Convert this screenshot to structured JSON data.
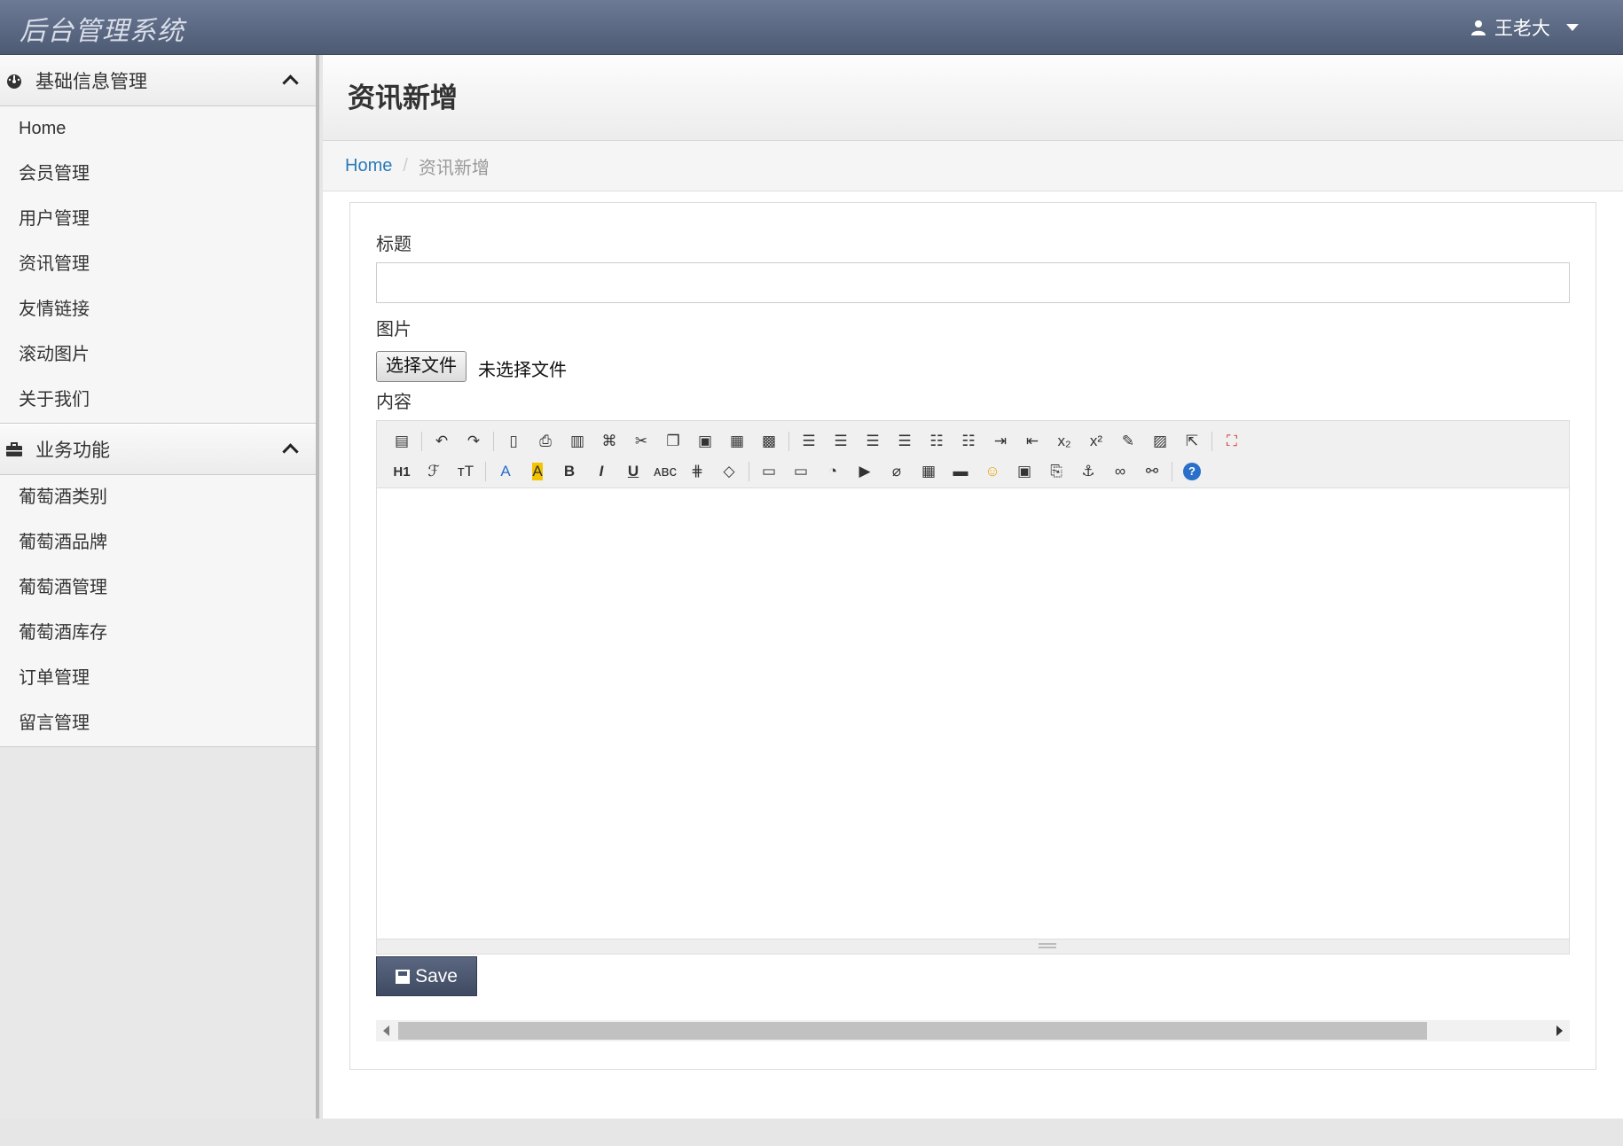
{
  "app": {
    "brand": "后台管理系统"
  },
  "header": {
    "user_name": "王老大",
    "user_icon": "user-icon"
  },
  "sidebar": {
    "groups": [
      {
        "title": "基础信息管理",
        "icon": "dashboard-icon",
        "items": [
          "Home",
          "会员管理",
          "用户管理",
          "资讯管理",
          "友情链接",
          "滚动图片",
          "关于我们"
        ]
      },
      {
        "title": "业务功能",
        "icon": "briefcase-icon",
        "items": [
          "葡萄酒类别",
          "葡萄酒品牌",
          "葡萄酒管理",
          "葡萄酒库存",
          "订单管理",
          "留言管理"
        ]
      }
    ]
  },
  "page": {
    "title": "资讯新增",
    "breadcrumb": {
      "home": "Home",
      "current": "资讯新增"
    }
  },
  "form": {
    "title_label": "标题",
    "title_value": "",
    "image_label": "图片",
    "file_button": "选择文件",
    "file_status": "未选择文件",
    "content_label": "内容",
    "save_label": "Save"
  },
  "editor_toolbar": {
    "row1": [
      "source-icon",
      "|",
      "undo-icon",
      "redo-icon",
      "|",
      "preview-icon",
      "print-icon",
      "template-icon",
      "code-icon",
      "cut-icon",
      "copy-icon",
      "paste-icon",
      "paste-text-icon",
      "paste-word-icon",
      "|",
      "align-left-icon",
      "align-center-icon",
      "align-right-icon",
      "align-justify-icon",
      "ordered-list-icon",
      "unordered-list-icon",
      "indent-icon",
      "outdent-icon",
      "subscript-icon",
      "superscript-icon",
      "clear-format-icon",
      "select-all-icon",
      "select-icon",
      "|",
      "fullscreen-icon"
    ],
    "row2": [
      "heading-icon",
      "font-family-icon",
      "font-size-icon",
      "|",
      "font-color-icon",
      "highlight-icon",
      "bold-icon",
      "italic-icon",
      "underline-icon",
      "strikethrough-icon",
      "line-height-icon",
      "eraser-icon",
      "|",
      "image-icon",
      "multi-image-icon",
      "flash-icon",
      "media-icon",
      "attachment-icon",
      "table-icon",
      "hr-icon",
      "emoticon-icon",
      "baidu-map-icon",
      "pagebreak-icon",
      "anchor-icon",
      "link-icon",
      "unlink-icon",
      "|",
      "help-icon"
    ]
  }
}
